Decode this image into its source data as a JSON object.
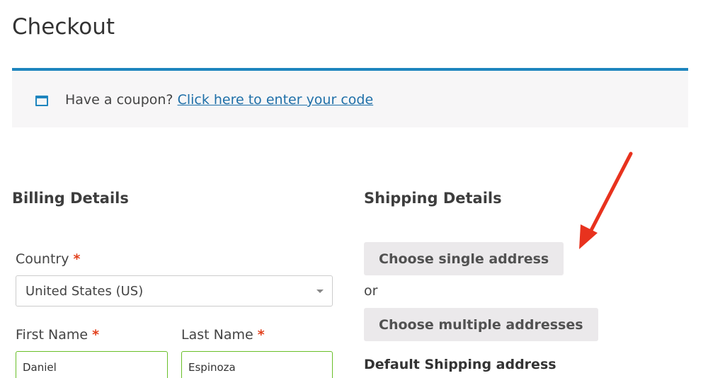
{
  "page": {
    "title": "Checkout"
  },
  "coupon_notice": {
    "text": "Have a coupon?",
    "link_text": "Click here to enter your code",
    "icon": "window-icon",
    "accent_color": "#1e85be"
  },
  "billing": {
    "heading": "Billing Details",
    "country_label": "Country",
    "country_value": "United States (US)",
    "first_name_label": "First Name",
    "first_name_value": "Daniel",
    "last_name_label": "Last Name",
    "last_name_value": "Espinoza",
    "required_marker": "*"
  },
  "shipping": {
    "heading": "Shipping Details",
    "single_address_button": "Choose single address",
    "or_text": "or",
    "multiple_addresses_button": "Choose multiple addresses",
    "default_address_heading": "Default Shipping address"
  },
  "annotation": {
    "icon": "arrow-icon",
    "color": "#e8321e"
  },
  "colors": {
    "required": "#e2401c",
    "valid_border": "#69bf29",
    "button_bg": "#ebe9eb",
    "notice_bg": "#f7f6f7"
  }
}
